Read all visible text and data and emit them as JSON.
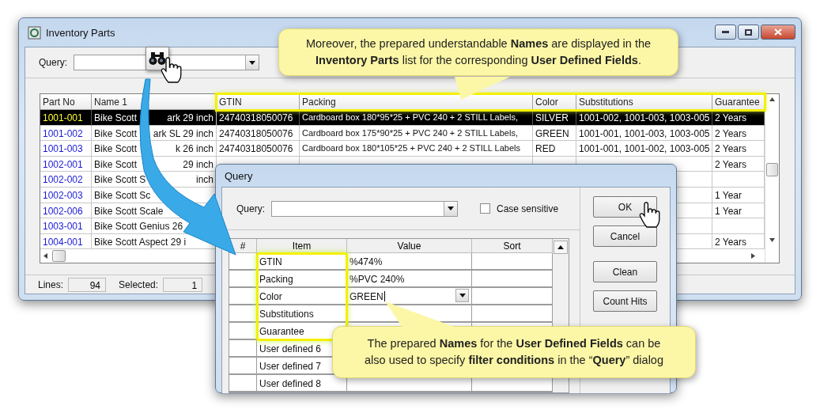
{
  "main_window": {
    "title": "Inventory Parts",
    "query_label": "Query:",
    "table": {
      "columns": [
        {
          "label": "Part No",
          "highlighted": false
        },
        {
          "label": "Name 1",
          "highlighted": false
        },
        {
          "label": "GTIN",
          "highlighted": true
        },
        {
          "label": "Packing",
          "highlighted": true
        },
        {
          "label": "Color",
          "highlighted": true
        },
        {
          "label": "Substitutions",
          "highlighted": true
        },
        {
          "label": "Guarantee",
          "highlighted": true
        }
      ],
      "rows": [
        {
          "part_no": "1001-001",
          "name_parts": [
            "Bike Scott",
            "ark 29 inch"
          ],
          "gtin": "24740318050076",
          "packing": "Cardboard box 180*95*25 + PVC 240 + 2 STILL Labels,",
          "colour_name": "SILVER",
          "substitutions": "1001-002, 1001-003, 1003-005",
          "guarantee": "2 Years",
          "selected": true
        },
        {
          "part_no": "1001-002",
          "name_parts": [
            "Bike Scott",
            "ark SL 29 inch"
          ],
          "gtin": "24740318050076",
          "packing": "Cardboard box 175*90*25 + PVC 240 + 2 STILL Labels,",
          "colour_name": "GREEN",
          "substitutions": "1001-001, 1001-003, 1003-005",
          "guarantee": "2 Years",
          "selected": false
        },
        {
          "part_no": "1001-003",
          "name_parts": [
            "Bike Scott",
            "k 26 inch"
          ],
          "gtin": "24740318050076",
          "packing": "Cardboard box 180*105*25 + PVC 240 + 2 STILL Labels",
          "colour_name": "RED",
          "substitutions": "1001-001, 1001-002, 1003-005",
          "guarantee": "2 Years",
          "selected": false
        },
        {
          "part_no": "1002-001",
          "name_parts": [
            "Bike Scott",
            "29 inch"
          ],
          "guarantee": "2 Years",
          "selected": false
        },
        {
          "part_no": "1002-002",
          "name_parts": [
            "Bike Scott S",
            "inch"
          ],
          "selected": false
        },
        {
          "part_no": "1002-003",
          "name_parts": [
            "Bike Scott Sc"
          ],
          "guarantee": "1 Year",
          "selected": false
        },
        {
          "part_no": "1002-006",
          "name_parts": [
            "Bike Scott Scale"
          ],
          "guarantee": "1 Year",
          "selected": false
        },
        {
          "part_no": "1003-001",
          "name_parts": [
            "Bike Scott Genius 26"
          ],
          "selected": false
        },
        {
          "part_no": "1004-001",
          "name_parts": [
            "Bike Scott Aspect 29 i"
          ],
          "guarantee": "2 Years",
          "selected": false
        }
      ]
    },
    "status_bar": {
      "lines_label": "Lines:",
      "lines": "94",
      "selected_label": "Selected:",
      "selected": "1"
    }
  },
  "query_dialog": {
    "title": "Query",
    "query_label": "Query:",
    "case_sensitive": {
      "label": "Case sensitive",
      "checked": false
    },
    "columns": [
      "#",
      "Item",
      "Value",
      "Sort"
    ],
    "rows": [
      {
        "item": "GTIN",
        "value": "%474%",
        "highlighted": true,
        "kind": "text"
      },
      {
        "item": "Packing",
        "value": "%PVC 240%",
        "highlighted": true,
        "kind": "text"
      },
      {
        "item": "Color",
        "value": "GREEN",
        "highlighted": true,
        "kind": "dropdown"
      },
      {
        "item": "Substitutions",
        "highlighted": true,
        "kind": "text"
      },
      {
        "item": "Guarantee",
        "highlighted": true,
        "kind": "text"
      },
      {
        "item": "User defined 6",
        "highlighted": false,
        "kind": "text"
      },
      {
        "item": "User defined 7",
        "highlighted": false,
        "kind": "text"
      },
      {
        "item": "User defined 8",
        "highlighted": false,
        "kind": "text"
      }
    ],
    "buttons": [
      "OK",
      "Cancel",
      "Clean",
      "Count Hits"
    ]
  },
  "callouts": [
    {
      "text": "Moreover, the prepared understandable **Names** are displayed in the **Inventory Parts** list for the corresponding **User Defined Fields**."
    },
    {
      "text": "The prepared **Names** for the **User Defined Fields** can be also used to specify **filter conditions** in the “**Query**” dialog"
    }
  ]
}
